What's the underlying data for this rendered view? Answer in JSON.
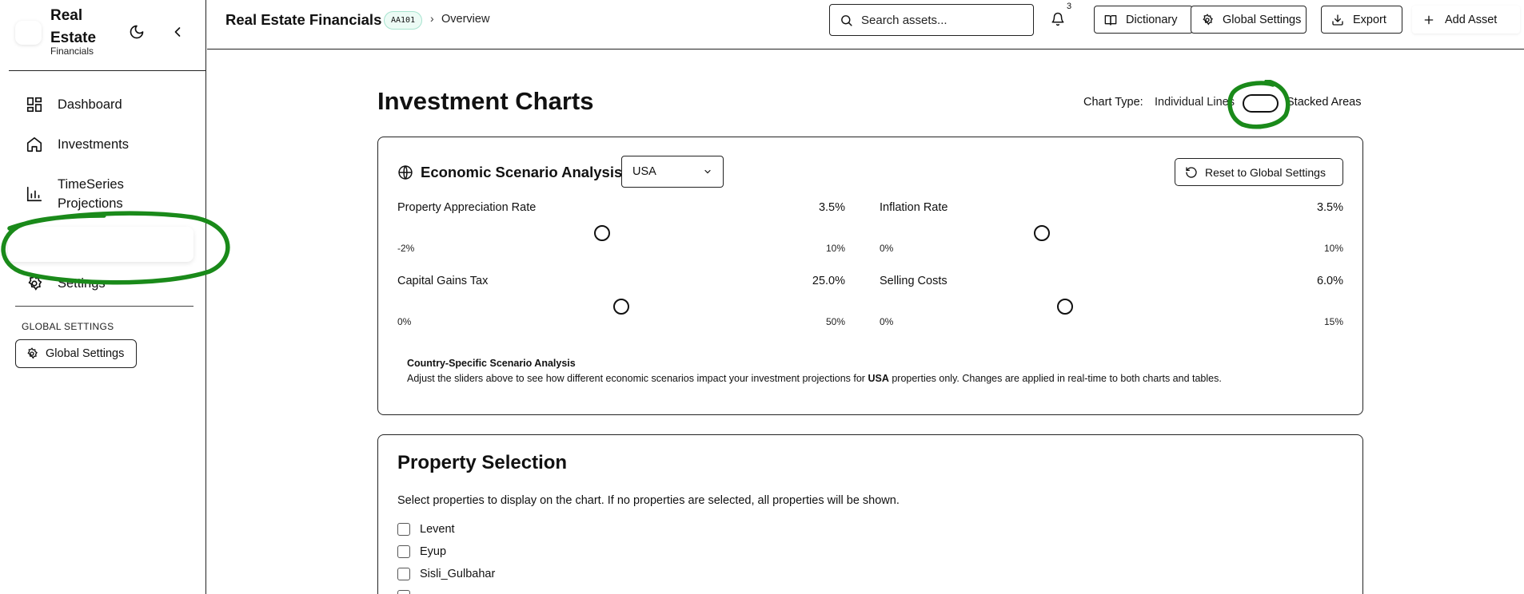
{
  "sidebar": {
    "brand_title": "Real Estate",
    "brand_subtitle": "Financials",
    "nav": [
      {
        "label": "Dashboard",
        "icon": "dashboard-icon"
      },
      {
        "label": "Investments",
        "icon": "home-icon"
      },
      {
        "label": "TimeSeries Projections",
        "icon": "bar-chart-icon"
      },
      {
        "label": "Settings",
        "icon": "gear-icon"
      }
    ],
    "section_label": "GLOBAL SETTINGS",
    "global_settings_button": "Global Settings"
  },
  "topbar": {
    "title": "Real Estate Financials",
    "badge": "AA101",
    "separator": "›",
    "page": "Overview",
    "search_placeholder": "Search assets...",
    "notification_count": "3",
    "dictionary_label": "Dictionary",
    "global_settings_label": "Global Settings",
    "export_label": "Export",
    "add_asset_label": "Add Asset"
  },
  "main": {
    "title": "Investment Charts",
    "chart_type_label": "Chart Type:",
    "chart_type_option_left": "Individual Lines",
    "chart_type_option_right": "Stacked Areas",
    "chart_type_stacked": false
  },
  "scenario": {
    "title": "Economic Scenario Analysis",
    "country": "USA",
    "reset_label": "Reset to Global Settings",
    "sliders": [
      {
        "label": "Property Appreciation Rate",
        "value": "3.5%",
        "min": "-2%",
        "max": "10%",
        "fraction": 0.458
      },
      {
        "label": "Inflation Rate",
        "value": "3.5%",
        "min": "0%",
        "max": "10%",
        "fraction": 0.35
      },
      {
        "label": "Capital Gains Tax",
        "value": "25.0%",
        "min": "0%",
        "max": "50%",
        "fraction": 0.5
      },
      {
        "label": "Selling Costs",
        "value": "6.0%",
        "min": "0%",
        "max": "15%",
        "fraction": 0.4
      }
    ],
    "note_title": "Country-Specific Scenario Analysis",
    "note_prefix": "Adjust the sliders above to see how different economic scenarios impact your investment projections for ",
    "note_country": "USA",
    "note_suffix": " properties only. Changes are applied in real-time to both charts and tables."
  },
  "properties": {
    "title": "Property Selection",
    "description": "Select properties to display on the chart. If no properties are selected, all properties will be shown.",
    "items": [
      "Levent",
      "Eyup",
      "Sisli_Gulbahar"
    ]
  },
  "colors": {
    "annotation": "#1a8a1a",
    "badge_bg": "#ecfbf5",
    "border": "#222222"
  }
}
